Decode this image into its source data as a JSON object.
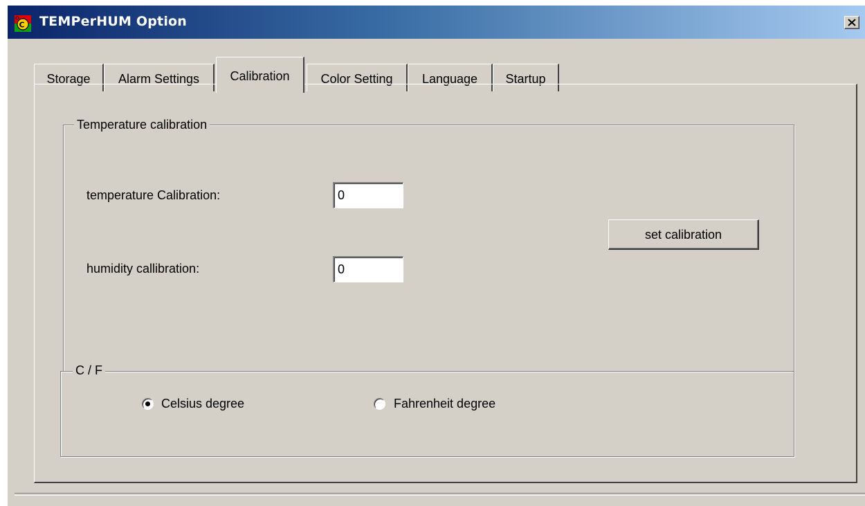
{
  "window": {
    "title": "TEMPerHUM Option",
    "close_icon": "close-icon"
  },
  "tabs": [
    {
      "label": "Storage",
      "active": false
    },
    {
      "label": "Alarm Settings",
      "active": false
    },
    {
      "label": "Calibration",
      "active": true
    },
    {
      "label": "Color Setting",
      "active": false
    },
    {
      "label": "Language",
      "active": false
    },
    {
      "label": "Startup",
      "active": false
    }
  ],
  "temperature_group": {
    "legend": "Temperature calibration",
    "temp_label": "temperature Calibration:",
    "temp_value": "0",
    "humidity_label": "humidity callibration:",
    "humidity_value": "0",
    "set_button": "set calibration"
  },
  "unit_group": {
    "legend": "C / F",
    "celsius_label": "Celsius degree",
    "celsius_selected": true,
    "fahrenheit_label": "Fahrenheit degree",
    "fahrenheit_selected": false
  },
  "colors": {
    "titlebar_start": "#0a246a",
    "titlebar_end": "#a6caf0",
    "face": "#d4d0c8"
  }
}
